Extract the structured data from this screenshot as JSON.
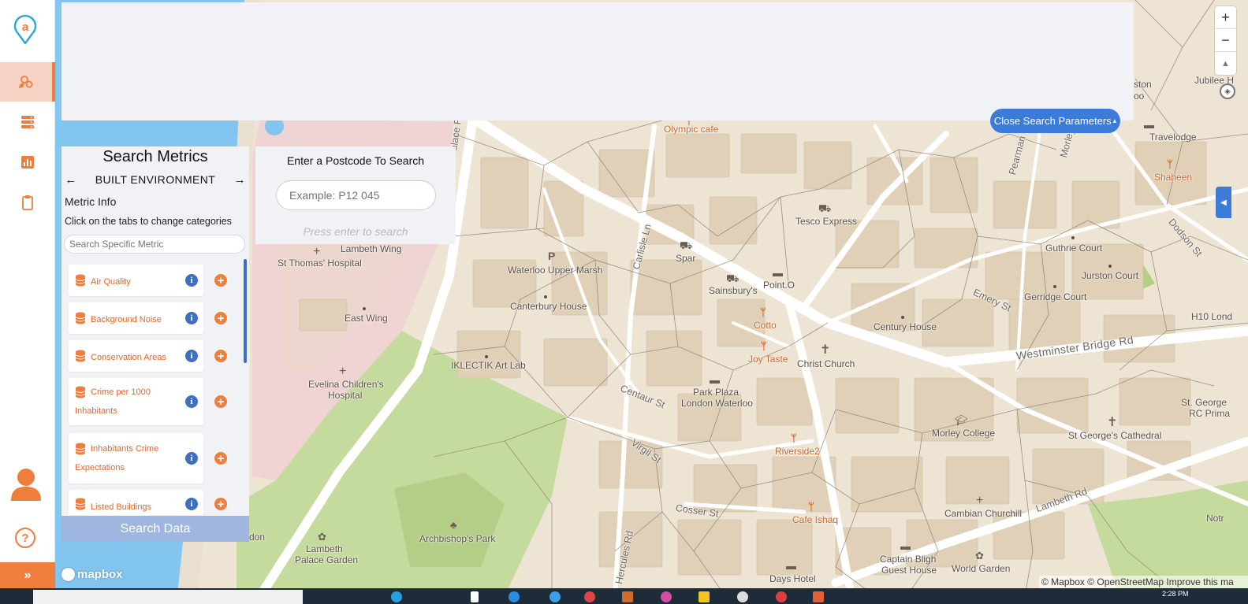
{
  "sidebar": {
    "logo_letter": "a",
    "nav": [
      "network-people-icon",
      "database-servers-icon",
      "bar-chart-icon",
      "clipboard-icon"
    ],
    "help_symbol": "?",
    "expand_symbol": "»",
    "colors": {
      "accent": "#ef7d3c",
      "active_bg": "#f5d2c3"
    }
  },
  "top_panel": {
    "close_button_label": "Close Search Parameters",
    "close_button_caret": "▴"
  },
  "metrics_panel": {
    "title": "Search Metrics",
    "category": "BUILT ENVIRONMENT",
    "prev_arrow": "←",
    "next_arrow": "→",
    "info_title": "Metric Info",
    "info_text": "Click on the tabs to change categories",
    "search_placeholder": "Search Specific Metric",
    "items": [
      {
        "label": "Air Quality"
      },
      {
        "label": "Background Noise"
      },
      {
        "label": "Conservation Areas"
      },
      {
        "label": "Crime per 1000 Inhabitants"
      },
      {
        "label": "Inhabitants Crime Expectations"
      },
      {
        "label": "Listed Buildings"
      }
    ],
    "info_symbol": "i",
    "add_symbol": "+",
    "search_button_label": "Search Data"
  },
  "postcode_panel": {
    "title": "Enter a Postcode To Search",
    "placeholder": "Example: P12 045",
    "hint": "Press enter to search"
  },
  "map_controls": {
    "zoom_in": "+",
    "zoom_out": "−",
    "reset_bearing": "▲",
    "side_tab": "◀"
  },
  "map": {
    "labels": {
      "olympic_cafe": "Olympic cafe",
      "travelodge": "Travelodge",
      "shaheen": "Shaheen",
      "jubilee": "Jubilee H",
      "lambeth_palace_rd": "Lambeth Palace Rd",
      "tesco": "Tesco Express",
      "pearman_st": "Pearman St",
      "guthrie_court": "Guthrie Court",
      "jurston_court": "Jurston Court",
      "dodson_st": "Dodson St",
      "lambeth_wing": "Lambeth Wing",
      "st_thomas": "St Thomas' Hospital",
      "waterloo_upper_marsh": "Waterloo Upper Marsh",
      "carlisle_ln": "Carlisle Ln",
      "spar": "Spar",
      "point_o": "Point.O",
      "sainsburys": "Sainsbury's",
      "emery_st": "Emery St",
      "gerridge_court": "Gerridge Court",
      "canterbury_house": "Canterbury House",
      "east_wing": "East Wing",
      "cotto": "Cotto",
      "century_house": "Century House",
      "h10_london": "H10 Lond",
      "joy_taste": "Joy Taste",
      "christ_church": "Christ Church",
      "westminster_bridge_rd": "Westminster Bridge Rd",
      "iklectik": "IKLECTIK Art Lab",
      "evelina_1": "Evelina Children's",
      "evelina_2": "Hospital",
      "centaur_st": "Centaur St",
      "park_plaza_1": "Park Plaza",
      "park_plaza_2": "London Waterloo",
      "morley_college": "Morley College",
      "st_george_rc_1": "St. George",
      "st_george_rc_2": "RC Prima",
      "st_georges_cathedral": "St George's Cathedral",
      "virgil_st": "Virgil St",
      "riverside2": "Riverside2",
      "cosser_st": "Cosser St",
      "cafe_ishaq": "Cafe Ishaq",
      "cambian": "Cambian Churchill",
      "lambeth_rd": "Lambeth Rd",
      "notre": "Notr",
      "lambeth_palace_garden_1": "Lambeth",
      "lambeth_palace_garden_2": "Palace Garden",
      "archbishops_park": "Archbishop's Park",
      "hercules_rd": "Hercules Rd",
      "captain_bligh_1": "Captain Bligh",
      "captain_bligh_2": "Guest House",
      "world_garden": "World Garden",
      "days_hotel": "Days Hotel",
      "ston": "ston",
      "oo": "oo",
      "don": "don",
      "morley_st": "Morley St"
    },
    "colors": {
      "land": "#ede4d4",
      "building": "#dfd0b7",
      "park": "#c5da9d",
      "water": "#82c5ef",
      "hospital": "#f0d3d3",
      "road": "#ffffff"
    }
  },
  "mapbox": {
    "logo_text": "mapbox",
    "attribution": "© Mapbox © OpenStreetMap Improve this ma"
  },
  "taskbar": {
    "clock": "2:28 PM"
  }
}
